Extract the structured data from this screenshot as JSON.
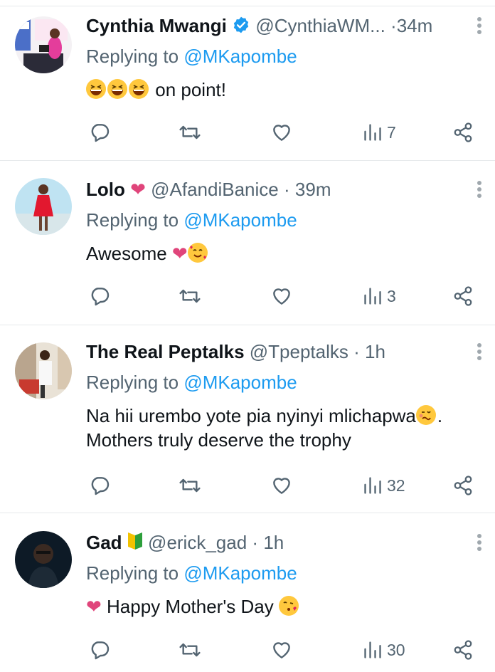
{
  "replies": [
    {
      "name": "Cynthia Mwangi",
      "handle": "@CynthiaWM...",
      "separator": "·",
      "time": "34m",
      "replying_prefix": "Replying to",
      "replying_to": "@MKapombe",
      "text": "on point!",
      "emoji_prefix": [
        "grinning-squinting-face-icon",
        "grinning-squinting-face-icon",
        "grinning-squinting-face-icon"
      ],
      "verified": true,
      "views": "7"
    },
    {
      "name": "Lolo",
      "handle": "@AfandiBanice",
      "separator": "·",
      "time": "39m",
      "replying_prefix": "Replying to",
      "replying_to": "@MKapombe",
      "text": "Awesome",
      "emoji_suffix": [
        "pink-heart-icon",
        "smiling-face-with-hearts-icon"
      ],
      "name_emoji": "pink-heart-icon",
      "views": "3"
    },
    {
      "name": "The Real Peptalks",
      "handle": "@Tpeptalks",
      "separator": "·",
      "time": "1h",
      "replying_prefix": "Replying to",
      "replying_to": "@MKapombe",
      "text_line1": "Na hii urembo yote pia nyinyi mlichapwa",
      "text_line1_end": ".",
      "text_line2": "Mothers truly deserve the trophy",
      "emoji_inline": "woozy-face-icon",
      "views": "32"
    },
    {
      "name": "Gad",
      "handle": "@erick_gad",
      "separator": "·",
      "time": "1h",
      "replying_prefix": "Replying to",
      "replying_to": "@MKapombe",
      "text": "Happy Mother's Day",
      "name_emoji": "beginner-symbol-icon",
      "emoji_prefix": [
        "pink-heart-icon"
      ],
      "emoji_suffix": [
        "face-blowing-kiss-icon"
      ],
      "views": "30"
    }
  ],
  "colors": {
    "accent": "#1d9bf0",
    "text": "#0f1419",
    "muted": "#536471",
    "divider": "#e6e9eb",
    "heart": "#e0457b"
  }
}
